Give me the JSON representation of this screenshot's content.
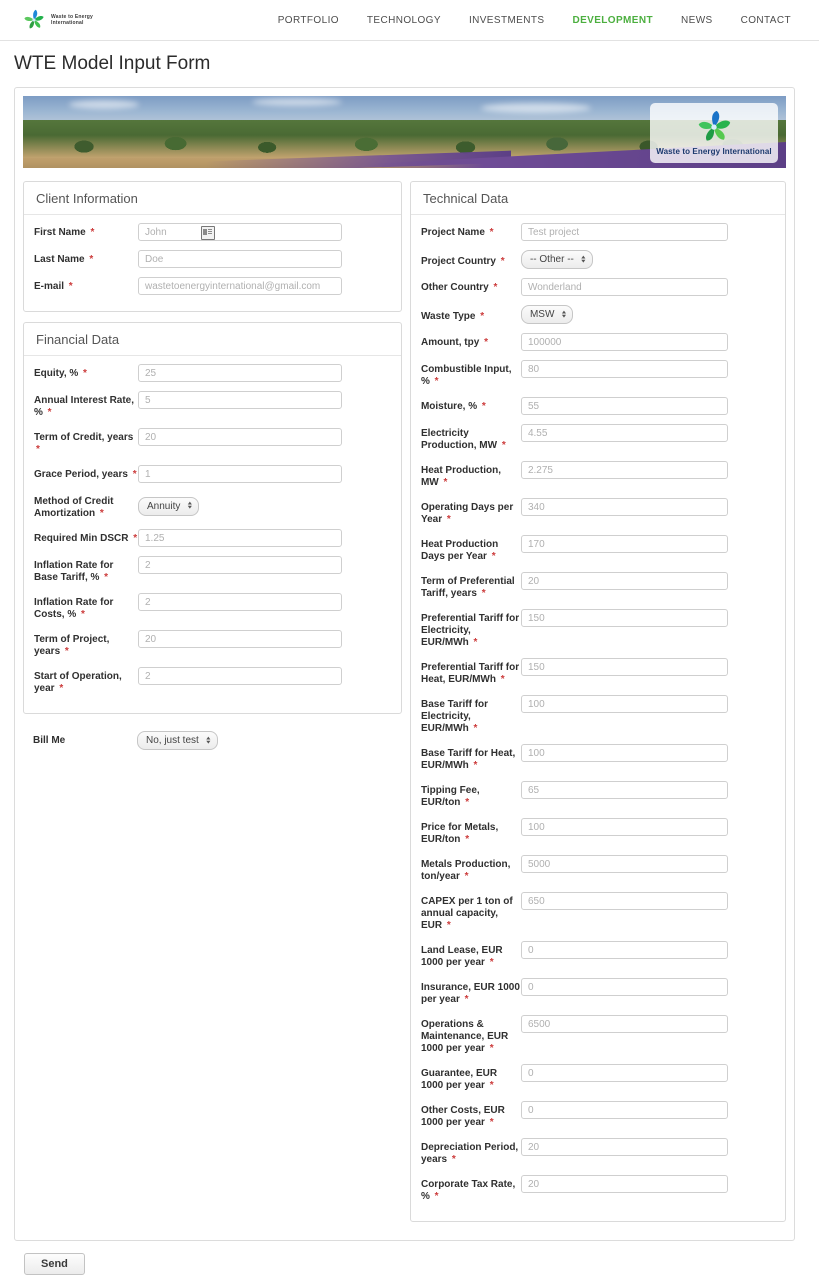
{
  "nav": {
    "brand_name": "Waste to Energy International",
    "links": [
      {
        "label": "PORTFOLIO",
        "active": false
      },
      {
        "label": "TECHNOLOGY",
        "active": false
      },
      {
        "label": "INVESTMENTS",
        "active": false
      },
      {
        "label": "DEVELOPMENT",
        "active": true
      },
      {
        "label": "NEWS",
        "active": false
      },
      {
        "label": "CONTACT",
        "active": false
      }
    ],
    "accent_color": "#4caf3f"
  },
  "page": {
    "title": "WTE Model Input Form"
  },
  "banner": {
    "logo_caption": "Waste to Energy International"
  },
  "client": {
    "legend": "Client Information",
    "fields": [
      {
        "label": "First Name",
        "required": true,
        "placeholder": "John",
        "type": "text",
        "has_autofill": true
      },
      {
        "label": "Last Name",
        "required": true,
        "placeholder": "Doe",
        "type": "text"
      },
      {
        "label": "E-mail",
        "required": true,
        "placeholder": "wastetoenergyinternational@gmail.com",
        "type": "text"
      }
    ]
  },
  "financial": {
    "legend": "Financial Data",
    "fields": [
      {
        "label": "Equity, %",
        "required": true,
        "placeholder": "25",
        "type": "text"
      },
      {
        "label": "Annual Interest Rate, %",
        "required": true,
        "placeholder": "5",
        "type": "text"
      },
      {
        "label": "Term of Credit, years",
        "required": true,
        "placeholder": "20",
        "type": "text"
      },
      {
        "label": "Grace Period, years",
        "required": true,
        "placeholder": "1",
        "type": "text"
      },
      {
        "label": "Method of Credit Amortization",
        "required": true,
        "value": "Annuity",
        "type": "select"
      },
      {
        "label": "Required Min DSCR",
        "required": true,
        "placeholder": "1.25",
        "type": "text"
      },
      {
        "label": "Inflation Rate for Base Tariff, %",
        "required": true,
        "placeholder": "2",
        "type": "text"
      },
      {
        "label": "Inflation Rate for Costs, %",
        "required": true,
        "placeholder": "2",
        "type": "text"
      },
      {
        "label": "Term of Project, years",
        "required": true,
        "placeholder": "20",
        "type": "text"
      },
      {
        "label": "Start of Operation, year",
        "required": true,
        "placeholder": "2",
        "type": "text"
      }
    ]
  },
  "billme": {
    "label": "Bill Me",
    "value": "No, just test"
  },
  "technical": {
    "legend": "Technical Data",
    "fields": [
      {
        "label": "Project Name",
        "required": true,
        "placeholder": "Test project",
        "type": "text"
      },
      {
        "label": "Project Country",
        "required": true,
        "value": "-- Other --",
        "type": "select"
      },
      {
        "label": "Other Country",
        "required": true,
        "placeholder": "Wonderland",
        "type": "text"
      },
      {
        "label": "Waste Type",
        "required": true,
        "value": "MSW",
        "type": "select"
      },
      {
        "label": "Amount, tpy",
        "required": true,
        "placeholder": "100000",
        "type": "text"
      },
      {
        "label": "Combustible Input, %",
        "required": true,
        "placeholder": "80",
        "type": "text"
      },
      {
        "label": "Moisture, %",
        "required": true,
        "placeholder": "55",
        "type": "text"
      },
      {
        "label": "Electricity Production, MW",
        "required": true,
        "placeholder": "4.55",
        "type": "text"
      },
      {
        "label": "Heat Production, MW",
        "required": true,
        "placeholder": "2.275",
        "type": "text"
      },
      {
        "label": "Operating Days per Year",
        "required": true,
        "placeholder": "340",
        "type": "text"
      },
      {
        "label": "Heat Production Days per Year",
        "required": true,
        "placeholder": "170",
        "type": "text"
      },
      {
        "label": "Term of Preferential Tariff, years",
        "required": true,
        "placeholder": "20",
        "type": "text"
      },
      {
        "label": "Preferential Tariff for Electricity, EUR/MWh",
        "required": true,
        "placeholder": "150",
        "type": "text"
      },
      {
        "label": "Preferential Tariff for Heat, EUR/MWh",
        "required": true,
        "placeholder": "150",
        "type": "text"
      },
      {
        "label": "Base Tariff for Electricity, EUR/MWh",
        "required": true,
        "placeholder": "100",
        "type": "text"
      },
      {
        "label": "Base Tariff for Heat, EUR/MWh",
        "required": true,
        "placeholder": "100",
        "type": "text"
      },
      {
        "label": "Tipping Fee, EUR/ton",
        "required": true,
        "placeholder": "65",
        "type": "text"
      },
      {
        "label": "Price for Metals, EUR/ton",
        "required": true,
        "placeholder": "100",
        "type": "text"
      },
      {
        "label": "Metals Production, ton/year",
        "required": true,
        "placeholder": "5000",
        "type": "text"
      },
      {
        "label": "CAPEX per 1 ton of annual capacity, EUR",
        "required": true,
        "placeholder": "650",
        "type": "text"
      },
      {
        "label": "Land Lease, EUR 1000 per year",
        "required": true,
        "placeholder": "0",
        "type": "text"
      },
      {
        "label": "Insurance, EUR 1000 per year",
        "required": true,
        "placeholder": "0",
        "type": "text"
      },
      {
        "label": "Operations & Maintenance, EUR 1000 per year",
        "required": true,
        "placeholder": "6500",
        "type": "text"
      },
      {
        "label": "Guarantee, EUR 1000 per year",
        "required": true,
        "placeholder": "0",
        "type": "text"
      },
      {
        "label": "Other Costs, EUR 1000 per year",
        "required": true,
        "placeholder": "0",
        "type": "text"
      },
      {
        "label": "Depreciation Period, years",
        "required": true,
        "placeholder": "20",
        "type": "text"
      },
      {
        "label": "Corporate Tax Rate, %",
        "required": true,
        "placeholder": "20",
        "type": "text"
      }
    ]
  },
  "submit": {
    "label": "Send"
  }
}
